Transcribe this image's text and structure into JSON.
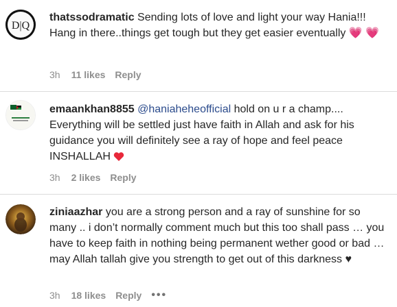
{
  "comments": [
    {
      "username": "thatssodramatic",
      "text_main": "Sending lots of love and light your way Hania!!! Hang in there..things get tough but they get easier eventually",
      "emoji": "💗 💗",
      "time": "3h",
      "likes": "11 likes",
      "reply": "Reply",
      "avatar_text": "D|Q"
    },
    {
      "username": "emaankhan8855",
      "mention": "@haniaheheofficial",
      "text_main": "hold on u r a champ.... Everything will be settled just have faith in Allah and ask for his guidance you will definitely see a ray of hope and feel peace INSHALLAH",
      "emoji": "❤️",
      "time": "3h",
      "likes": "2 likes",
      "reply": "Reply"
    },
    {
      "username": "ziniaazhar",
      "text_main": "you are a strong person and a ray of sunshine for so many .. i don’t normally comment much but this too shall pass … you have to keep faith in nothing being permanent wether good or bad … may Allah tallah give you strength to get out of this darkness",
      "emoji": "♥",
      "time": "3h",
      "likes": "18 likes",
      "reply": "Reply",
      "more": "•••"
    }
  ],
  "colors": {
    "text": "#262626",
    "meta": "#8e8e8e",
    "mention": "#2b4b8c",
    "divider": "#dbdbdb"
  }
}
